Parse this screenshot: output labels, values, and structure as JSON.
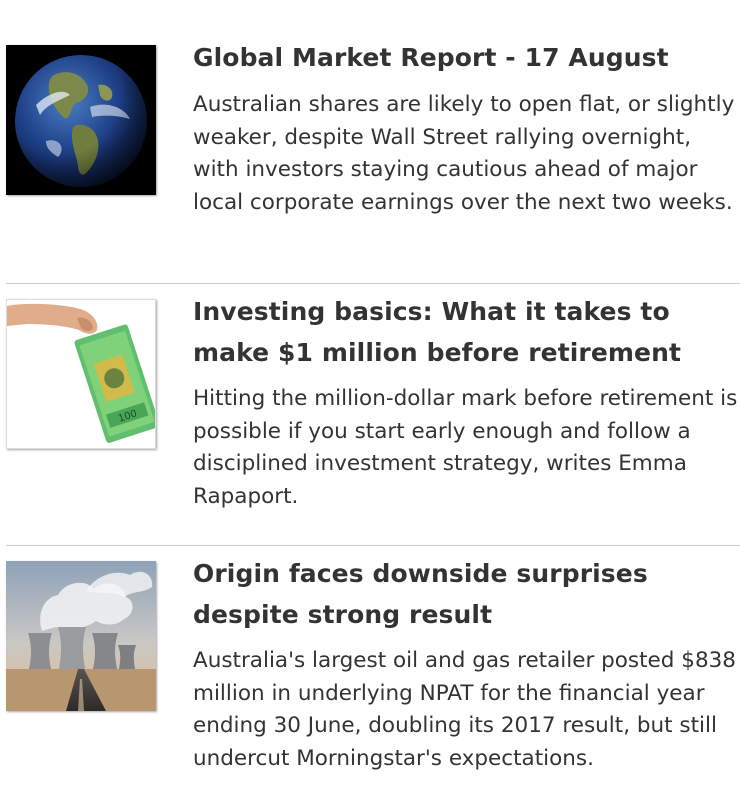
{
  "articles": [
    {
      "headline": "Global Market Report - 17 August",
      "summary": "Australian shares are likely to open flat, or slightly weaker, despite Wall Street rallying overnight, with investors staying cautious ahead of major local corporate earnings over the next two weeks.",
      "thumbnail": "earth-globe-image"
    },
    {
      "headline": "Investing basics: What it takes to make $1 million before retirement",
      "summary": "Hitting the million-dollar mark before retirement is possible if you start early enough and follow a disciplined investment strategy, writes Emma Rapaport.",
      "thumbnail": "hand-holding-banknote-image"
    },
    {
      "headline": "Origin faces downside surprises despite strong result",
      "summary": "Australia's largest oil and gas retailer posted $838 million in underlying NPAT for the financial year ending 30 June, doubling its 2017 result, but still undercut Morningstar's expectations.",
      "thumbnail": "cooling-towers-image"
    }
  ]
}
